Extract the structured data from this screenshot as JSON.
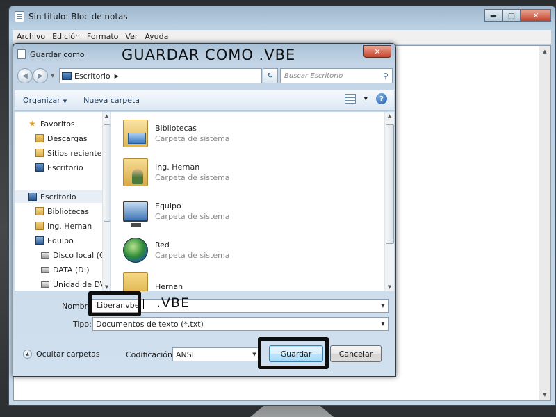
{
  "notepad": {
    "title": "Sin título: Bloc de notas",
    "menu": [
      "Archivo",
      "Edición",
      "Formato",
      "Ver",
      "Ayuda"
    ],
    "controls": {
      "minimize": "▬",
      "maximize": "▢",
      "close": "✕"
    }
  },
  "dialog": {
    "title": "Guardar como",
    "close": "✕",
    "annotation_title": "GUARDAR COMO .VBE",
    "address": {
      "location": "Escritorio"
    },
    "search": {
      "placeholder": "Buscar Escritorio"
    },
    "toolbar": {
      "organize": "Organizar",
      "new_folder": "Nueva carpeta",
      "help": "?"
    },
    "nav_pane": {
      "favorites": "Favoritos",
      "favorites_items": [
        "Descargas",
        "Sitios recientes",
        "Escritorio"
      ],
      "desktop": "Escritorio",
      "desktop_items": [
        "Bibliotecas",
        "Ing. Hernan",
        "Equipo"
      ],
      "drives": [
        "Disco local (C:)",
        "DATA (D:)",
        "Unidad de DVD"
      ]
    },
    "files": [
      {
        "name": "Bibliotecas",
        "type": "Carpeta de sistema"
      },
      {
        "name": "Ing. Hernan",
        "type": "Carpeta de sistema"
      },
      {
        "name": "Equipo",
        "type": "Carpeta de sistema"
      },
      {
        "name": "Red",
        "type": "Carpeta de sistema"
      },
      {
        "name": "Hernan",
        "type": ""
      }
    ],
    "filename_label": "Nombre",
    "filename_value": "Liberar.vbe",
    "filename_annotation": ".VBE",
    "filetype_label": "Tipo:",
    "filetype_value": "Documentos de texto (*.txt)",
    "encoding_label": "Codificación:",
    "encoding_value": "ANSI",
    "hide_folders": "Ocultar carpetas",
    "save_button": "Guardar",
    "cancel_button": "Cancelar"
  }
}
